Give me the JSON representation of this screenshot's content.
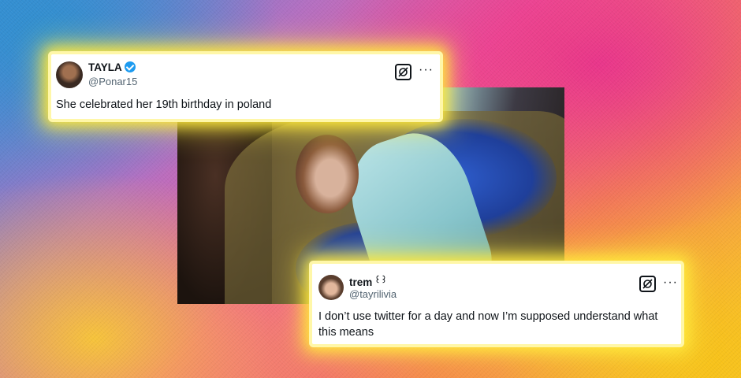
{
  "tweet1": {
    "name": "TAYLA",
    "handle": "@Ponar15",
    "text": "She celebrated her 19th birthday in poland",
    "verified": true,
    "icons": [
      "avatar",
      "verified-badge-icon",
      "grok-icon",
      "more-options-icon"
    ]
  },
  "tweet2": {
    "name": "trem",
    "name_emoji": "꒰꒱",
    "handle": "@tayrilivia",
    "text": "I don’t use twitter for a day and now I’m supposed understand what this means",
    "icons": [
      "avatar",
      "grok-icon",
      "more-options-icon"
    ]
  },
  "more_label": "···",
  "colors": {
    "glow": "#ffe93b",
    "verified": "#1d9bf0",
    "text": "#0f1419",
    "muted": "#536471"
  }
}
